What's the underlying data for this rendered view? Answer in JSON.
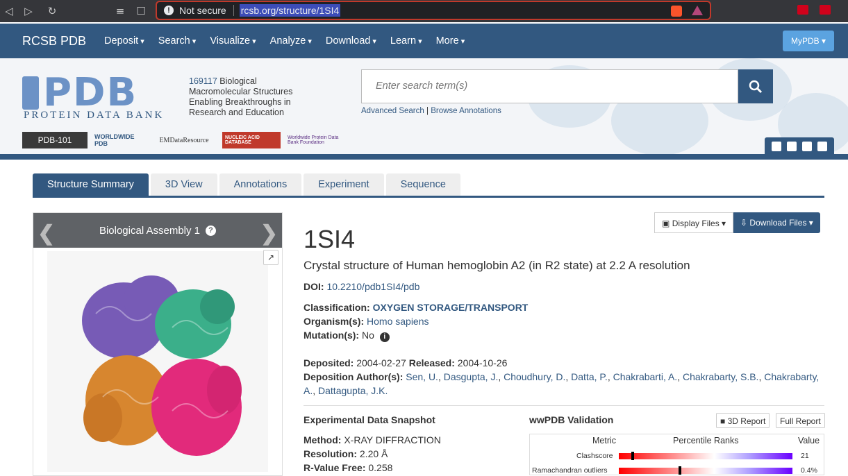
{
  "browser": {
    "security_label": "Not secure",
    "url": "rcsb.org/structure/1SI4"
  },
  "topnav": {
    "brand": "RCSB PDB",
    "menus": [
      "Deposit",
      "Search",
      "Visualize",
      "Analyze",
      "Download",
      "Learn",
      "More"
    ],
    "mypdb": "MyPDB"
  },
  "header": {
    "logo_text": "PDB",
    "logo_sub": "PROTEIN DATA BANK",
    "tagline_count": "169117",
    "tagline_text": " Biological Macromolecular Structures Enabling Breakthroughs in Research and Education",
    "search_placeholder": "Enter search term(s)",
    "advanced_search": "Advanced Search",
    "browse_annotations": "Browse Annotations",
    "partners": [
      "PDB-101",
      "WORLDWIDE PDB",
      "EMDataResource",
      "NUCLEIC ACID DATABASE",
      "Worldwide Protein Data Bank Foundation"
    ]
  },
  "tabs": [
    "Structure Summary",
    "3D View",
    "Annotations",
    "Experiment",
    "Sequence"
  ],
  "assembly": {
    "title": "Biological Assembly 1"
  },
  "buttons": {
    "display_files": "Display Files",
    "download_files": "Download Files"
  },
  "entry": {
    "id": "1SI4",
    "title": "Crystal structure of Human hemoglobin A2 (in R2 state) at 2.2 A resolution",
    "doi_label": "DOI:",
    "doi": "10.2210/pdb1SI4/pdb",
    "classification_label": "Classification:",
    "classification": "OXYGEN STORAGE/TRANSPORT",
    "organism_label": "Organism(s):",
    "organism": "Homo sapiens",
    "mutation_label": "Mutation(s):",
    "mutation": "No",
    "deposited_label": "Deposited:",
    "deposited": "2004-02-27",
    "released_label": "Released:",
    "released": "2004-10-26",
    "authors_label": "Deposition Author(s):",
    "authors_line1": [
      "Sen, U.",
      "Dasgupta, J.",
      "Choudhury, D.",
      "Datta, P.",
      "Chakrabarti, A.",
      "Chakrabarty, S.B.",
      "Chakrabarty,"
    ],
    "authors_line2": [
      "A.",
      "Dattagupta, J.K."
    ]
  },
  "experimental": {
    "title": "Experimental Data Snapshot",
    "method_label": "Method:",
    "method": "X-RAY DIFFRACTION",
    "resolution_label": "Resolution:",
    "resolution": "2.20 Å",
    "rfree_label": "R-Value Free:",
    "rfree": "0.258"
  },
  "validation": {
    "title": "wwPDB Validation",
    "report_3d": "3D Report",
    "report_full": "Full Report",
    "col_metric": "Metric",
    "col_percentile": "Percentile Ranks",
    "col_value": "Value",
    "rows": [
      {
        "metric": "Clashscore",
        "value": "21"
      },
      {
        "metric": "Ramachandran outliers",
        "value": "0.4%"
      }
    ]
  }
}
